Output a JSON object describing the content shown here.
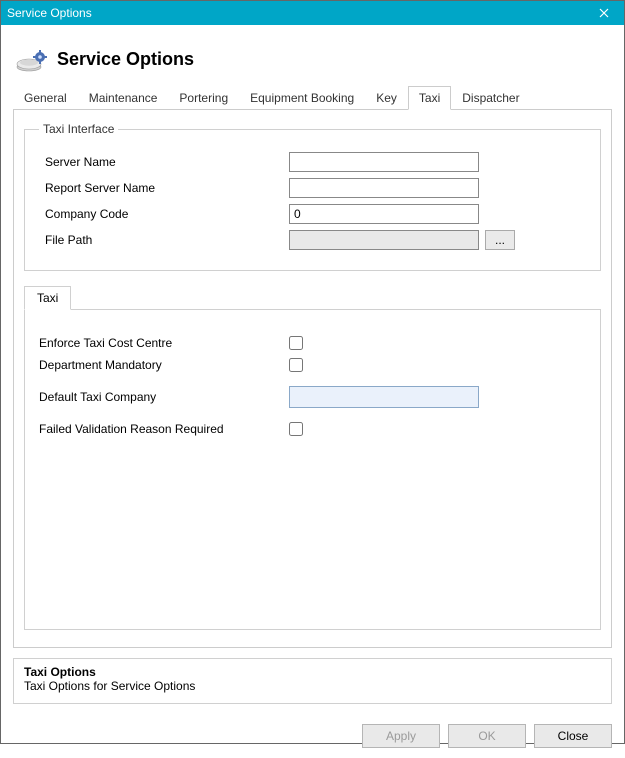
{
  "window": {
    "title": "Service Options"
  },
  "header": {
    "title": "Service Options"
  },
  "tabs": {
    "general": "General",
    "maintenance": "Maintenance",
    "portering": "Portering",
    "equipment_booking": "Equipment Booking",
    "key": "Key",
    "taxi": "Taxi",
    "dispatcher": "Dispatcher",
    "active": "taxi"
  },
  "taxi_interface": {
    "legend": "Taxi Interface",
    "fields": {
      "server_name": {
        "label": "Server Name",
        "value": ""
      },
      "report_server_name": {
        "label": "Report Server Name",
        "value": ""
      },
      "company_code": {
        "label": "Company Code",
        "value": "0"
      },
      "file_path": {
        "label": "File Path",
        "value": ""
      }
    },
    "browse_label": "..."
  },
  "inner_tabs": {
    "taxi": "Taxi",
    "active": "taxi"
  },
  "taxi_options": {
    "enforce_cost_centre": {
      "label": "Enforce Taxi Cost Centre",
      "checked": false
    },
    "department_mandatory": {
      "label": "Department Mandatory",
      "checked": false
    },
    "default_company": {
      "label": "Default Taxi Company",
      "value": ""
    },
    "failed_validation_required": {
      "label": "Failed Validation Reason Required",
      "checked": false
    }
  },
  "description": {
    "title": "Taxi Options",
    "text": "Taxi Options for Service Options"
  },
  "buttons": {
    "apply": "Apply",
    "ok": "OK",
    "close": "Close"
  }
}
